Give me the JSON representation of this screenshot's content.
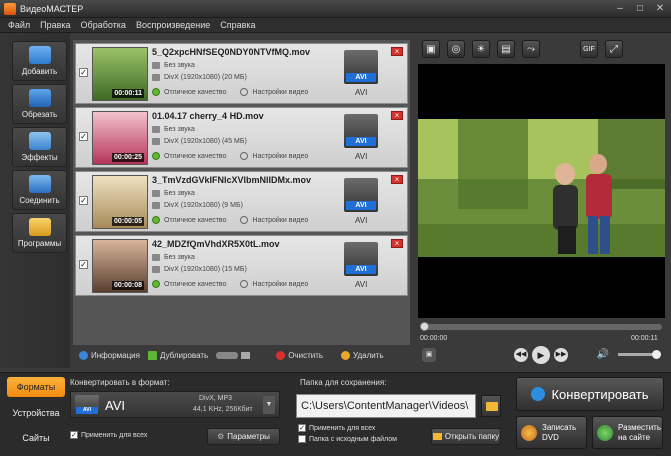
{
  "window": {
    "title": "ВидеоМАСТЕР",
    "controls": [
      "–",
      "□",
      "✕"
    ]
  },
  "menu": [
    "Файл",
    "Правка",
    "Обработка",
    "Воспроизведение",
    "Справка"
  ],
  "left_tools": [
    {
      "label": "Добавить",
      "icon": "add-file-icon",
      "color": "#3d8fd8"
    },
    {
      "label": "Обрезать",
      "icon": "scissors-icon",
      "color": "#2f7bd0"
    },
    {
      "label": "Эффекты",
      "icon": "effects-icon",
      "color": "#5aa4e0"
    },
    {
      "label": "Соединить",
      "icon": "join-icon",
      "color": "#4a90d9"
    },
    {
      "label": "Программы",
      "icon": "programs-icon",
      "color": "#e8b33a"
    }
  ],
  "files": [
    {
      "name": "5_Q2xpcHNfSEQ0NDY0NTVfMQ.mov",
      "audio": "Без звука",
      "codec": "DivX (1920x1080) (20 MБ)",
      "quality": "Отличное качество",
      "settings": "Настройки видео",
      "duration": "00:00:11",
      "format": "AVI",
      "thumb_color": "#6a8f3a",
      "checked": "✓"
    },
    {
      "name": "01.04.17 cherry_4 HD.mov",
      "audio": "Без звука",
      "codec": "DivX (1920x1080) (45 MБ)",
      "quality": "Отличное качество",
      "settings": "Настройки видео",
      "duration": "00:00:25",
      "format": "AVI",
      "thumb_color": "#b5345a",
      "checked": "✓"
    },
    {
      "name": "3_TmVzdGVkIFNlcXVlbmNlIDMx.mov",
      "audio": "Без звука",
      "codec": "DivX (1920x1080) (9 MБ)",
      "quality": "Отличное качество",
      "settings": "Настройки видео",
      "duration": "00:00:05",
      "format": "AVI",
      "thumb_color": "#c8b48a",
      "checked": "✓"
    },
    {
      "name": "42_MDZfQmVhdXR5X0tL.mov",
      "audio": "Без звука",
      "codec": "DivX (1920x1080) (15 MБ)",
      "quality": "Отличное качество",
      "settings": "Настройки видео",
      "duration": "00:00:08",
      "format": "AVI",
      "thumb_color": "#8a6a55",
      "checked": "✓"
    }
  ],
  "list_bar": {
    "info": "Информация",
    "duplicate": "Дублировать",
    "clear": "Очистить",
    "delete": "Удалить"
  },
  "preview_tools": [
    "▣",
    "◎",
    "☀",
    "▤",
    "⤳",
    "GIF",
    "⤢"
  ],
  "player": {
    "time_start": "00:00:00",
    "time_end": "00:00:11",
    "progress": 0
  },
  "bottom_tabs": [
    "Форматы",
    "Устройства",
    "Сайты"
  ],
  "convert_section": {
    "label": "Конвертировать в формат:",
    "format": "AVI",
    "desc1": "DivX, MP3",
    "desc2": "44,1 KHz, 256Кбит",
    "apply_all": "Применить для всех",
    "params": "Параметры"
  },
  "save_section": {
    "label": "Папка для сохранения:",
    "path": "C:\\Users\\ContentManager\\Videos\\",
    "apply_all": "Применить для всех",
    "same_folder": "Папка с исходным файлом",
    "open_folder": "Открыть папку"
  },
  "actions": {
    "convert": "Конвертировать",
    "burn_dvd": "Записать DVD",
    "publish": "Разместить на сайте"
  }
}
